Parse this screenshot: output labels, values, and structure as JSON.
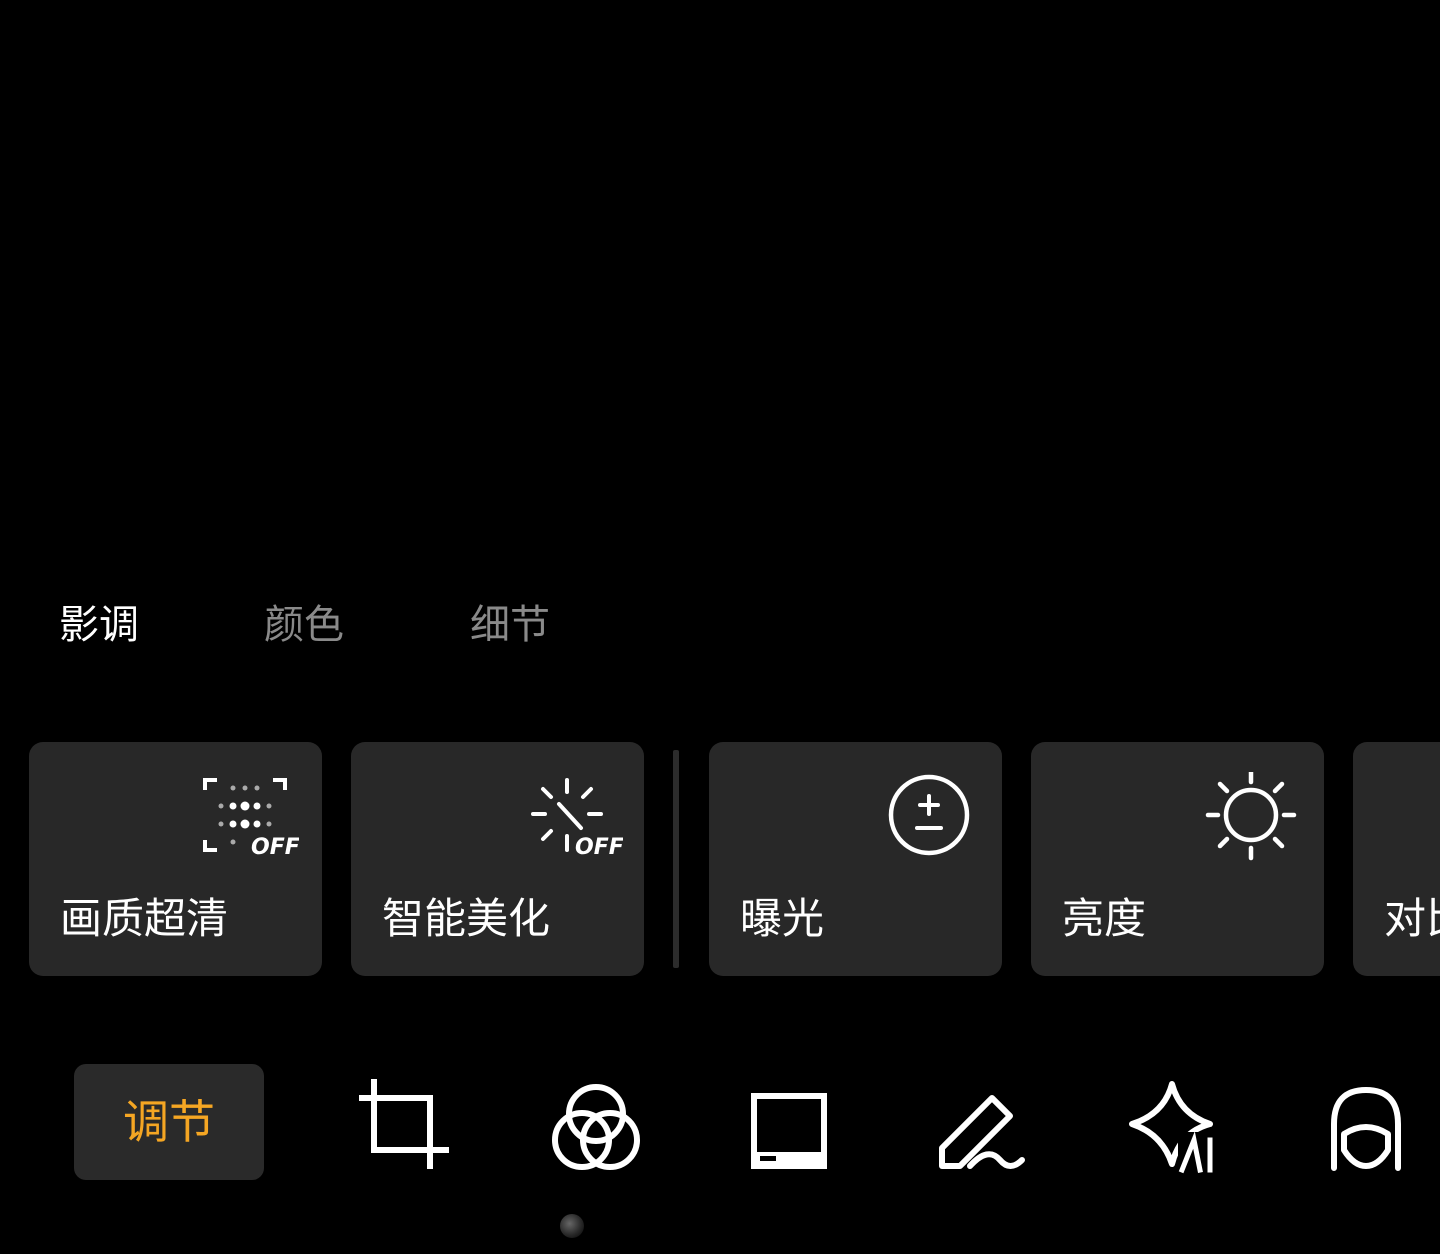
{
  "subtabs": [
    {
      "label": "影调",
      "active": true
    },
    {
      "label": "颜色",
      "active": false
    },
    {
      "label": "细节",
      "active": false
    }
  ],
  "cards": [
    {
      "label": "画质超清",
      "icon": "super-resolution-off-icon",
      "badge": "OFF"
    },
    {
      "label": "智能美化",
      "icon": "auto-enhance-off-icon",
      "badge": "OFF"
    },
    {
      "label": "曝光",
      "icon": "exposure-icon"
    },
    {
      "label": "亮度",
      "icon": "brightness-icon"
    },
    {
      "label": "对比度",
      "icon": "contrast-icon"
    }
  ],
  "bottom_bar": {
    "active_label": "调节",
    "accent_color": "#f5a623",
    "tools": [
      "crop-icon",
      "filter-icon",
      "frame-icon",
      "draw-icon",
      "ai-icon",
      "portrait-icon"
    ]
  }
}
